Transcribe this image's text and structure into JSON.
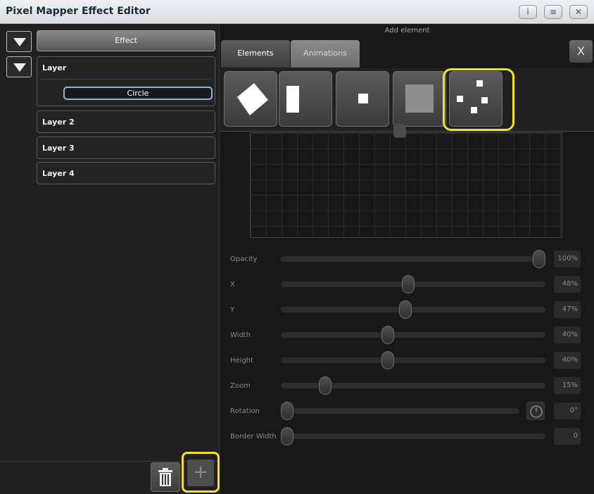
{
  "window": {
    "title": "Pixel Mapper Effect Editor",
    "info_icon": "i",
    "menu_icon": "≡",
    "close_icon": "✕"
  },
  "left_panel": {
    "effect_label": "Effect",
    "layers": [
      {
        "label": "Layer",
        "child": "Circle"
      },
      {
        "label": "Layer 2"
      },
      {
        "label": "Layer 3"
      },
      {
        "label": "Layer 4"
      }
    ],
    "add_label": "+"
  },
  "right_panel": {
    "header": "Add element",
    "tabs": [
      "Elements",
      "Animations"
    ],
    "close_label": "X",
    "element_icons": [
      "rotated-square-icon",
      "bar-icon",
      "small-square-icon",
      "large-square-icon",
      "scatter-dots-icon"
    ],
    "properties": [
      {
        "label": "Opacity",
        "value": "100%",
        "level": 1.0
      },
      {
        "label": "X",
        "value": "48%",
        "level": 0.48
      },
      {
        "label": "Y",
        "value": "47%",
        "level": 0.47
      },
      {
        "label": "Width",
        "value": "40%",
        "level": 0.4
      },
      {
        "label": "Height",
        "value": "40%",
        "level": 0.4
      },
      {
        "label": "Zoom",
        "value": "15%",
        "level": 0.15
      },
      {
        "label": "Rotation",
        "value": "0°",
        "level": 0.0
      },
      {
        "label": "Border Width",
        "value": "0",
        "level": 0.0
      }
    ]
  },
  "colors": {
    "highlight": "#f3e21a",
    "selected_outline": "#87b7e0"
  }
}
